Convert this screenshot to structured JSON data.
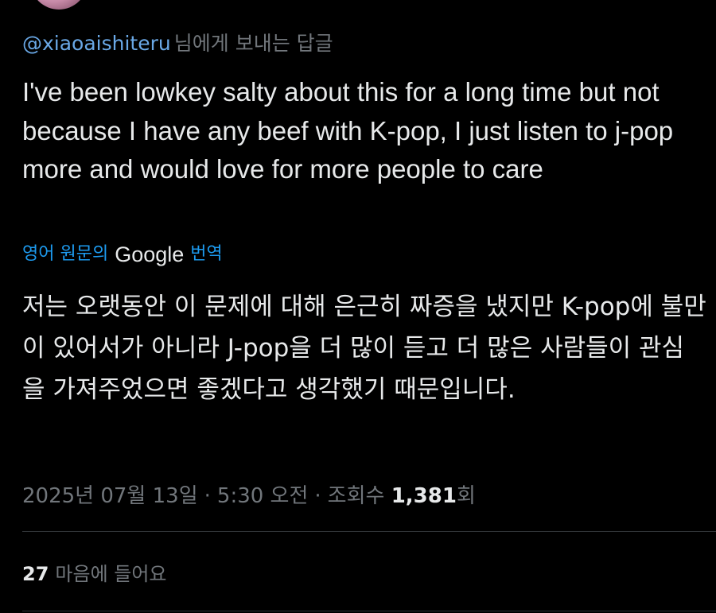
{
  "reply_header": {
    "handle": "@xiaoaishiteru",
    "suffix": "님에게 보내는 답글"
  },
  "tweet": {
    "text": "I've been lowkey salty about this for a long time but not because I have any beef with K-pop, I just listen to j-pop more and would love for more people to care",
    "translate_prefix": "영어 원문의",
    "translate_brand": "Google",
    "translate_suffix": "번역",
    "translated_text": "저는 오랫동안 이 문제에 대해 은근히 짜증을 냈지만 K-pop에 불만이 있어서가 아니라 J-pop을 더 많이 듣고 더 많은 사람들이 관심을 가져주었으면 좋겠다고 생각했기 때문입니다."
  },
  "meta": {
    "date": "2025년 07월 13일",
    "separator": "·",
    "time": "5:30 오전",
    "views_label": "조회수",
    "views_count": "1,381",
    "views_unit": "회"
  },
  "engagement": {
    "likes_count": "27",
    "likes_label": "마음에 들어요"
  },
  "colors": {
    "background": "#000000",
    "text": "#e7e9ea",
    "secondary": "#71767b",
    "link": "#1d9bf0",
    "divider": "#2f3336"
  }
}
